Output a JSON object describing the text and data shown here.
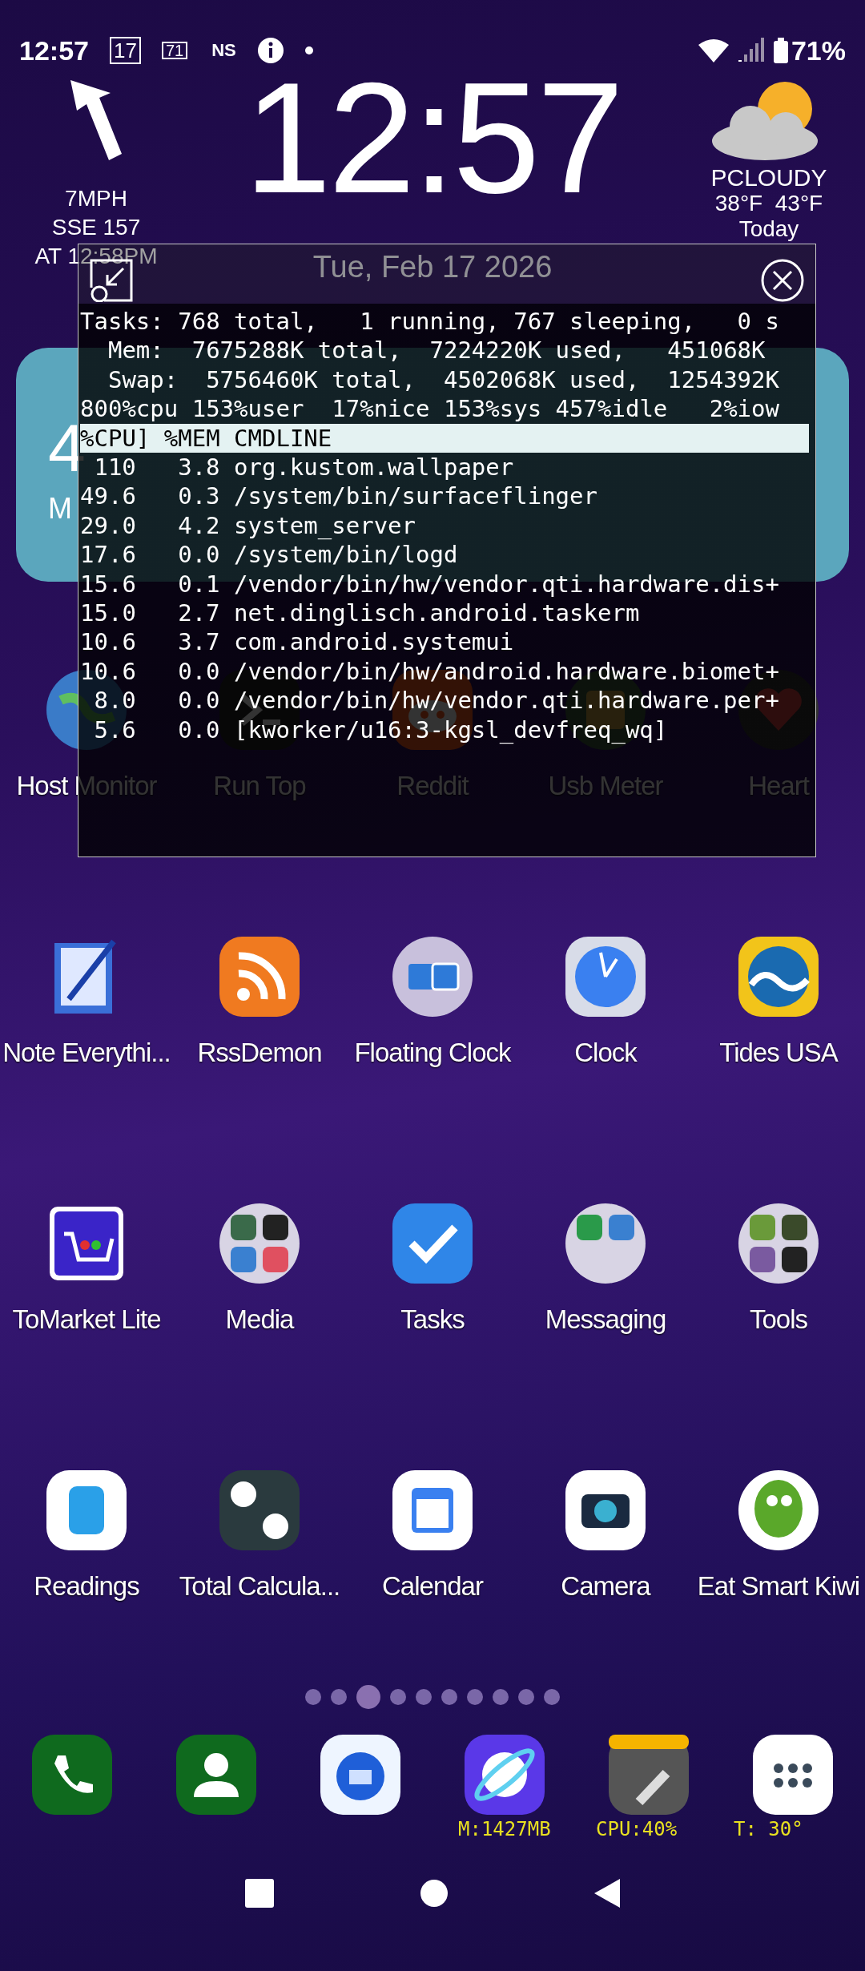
{
  "status_bar": {
    "time": "12:57",
    "badges": [
      {
        "kind": "box",
        "text": "17"
      },
      {
        "kind": "battery",
        "text": "71"
      },
      {
        "kind": "plain",
        "text": "NS"
      }
    ],
    "battery": "71%"
  },
  "wind": {
    "speed": "7MPH",
    "direction": "SSE 157",
    "updated": "AT 12:58PM"
  },
  "clock": {
    "time": "12:57",
    "date": "Tue, Feb 17 2026"
  },
  "weather": {
    "condition": "PCLOUDY",
    "range": "38°F  43°F",
    "day": "Today"
  },
  "weather_widget": {
    "temperature": "4",
    "condition": "M"
  },
  "top_overlay": {
    "summary": [
      "Tasks: 768 total,   1 running, 767 sleeping,   0 s",
      "  Mem:  7675288K total,  7224220K used,   451068K",
      "  Swap:  5756460K total,  4502068K used,  1254392K",
      "800%cpu 153%user  17%nice 153%sys 457%idle   2%iow"
    ],
    "header": "%CPU] %MEM CMDLINE",
    "processes": [
      {
        "cpu": "110",
        "mem": "3.8",
        "cmdline": "org.kustom.wallpaper"
      },
      {
        "cpu": "49.6",
        "mem": "0.3",
        "cmdline": "/system/bin/surfaceflinger"
      },
      {
        "cpu": "29.0",
        "mem": "4.2",
        "cmdline": "system_server"
      },
      {
        "cpu": "17.6",
        "mem": "0.0",
        "cmdline": "/system/bin/logd"
      },
      {
        "cpu": "15.6",
        "mem": "0.1",
        "cmdline": "/vendor/bin/hw/vendor.qti.hardware.dis+"
      },
      {
        "cpu": "15.0",
        "mem": "2.7",
        "cmdline": "net.dinglisch.android.taskerm"
      },
      {
        "cpu": "10.6",
        "mem": "3.7",
        "cmdline": "com.android.systemui"
      },
      {
        "cpu": "10.6",
        "mem": "0.0",
        "cmdline": "/vendor/bin/hw/android.hardware.biomet+"
      },
      {
        "cpu": "8.0",
        "mem": "0.0",
        "cmdline": "/vendor/bin/hw/vendor.qti.hardware.per+"
      },
      {
        "cpu": "5.6",
        "mem": "0.0",
        "cmdline": "[kworker/u16:3-kgsl_devfreq_wq]"
      }
    ]
  },
  "app_rows": [
    [
      {
        "label": "Host Monitor"
      },
      {
        "label": "Run Top"
      },
      {
        "label": "Reddit"
      },
      {
        "label": "Usb Meter"
      },
      {
        "label": "Heart"
      }
    ],
    [
      {
        "label": "Note Everythi..."
      },
      {
        "label": "RssDemon"
      },
      {
        "label": "Floating Clock"
      },
      {
        "label": "Clock"
      },
      {
        "label": "Tides USA"
      }
    ],
    [
      {
        "label": "ToMarket Lite"
      },
      {
        "label": "Media"
      },
      {
        "label": "Tasks"
      },
      {
        "label": "Messaging"
      },
      {
        "label": "Tools"
      }
    ],
    [
      {
        "label": "Readings"
      },
      {
        "label": "Total Calcula..."
      },
      {
        "label": "Calendar"
      },
      {
        "label": "Camera"
      },
      {
        "label": "Eat Smart Kiwi"
      }
    ]
  ],
  "page_dots": [
    {
      "selected": false
    },
    {
      "selected": false
    },
    {
      "selected": true
    },
    {
      "selected": false
    },
    {
      "selected": false
    },
    {
      "selected": false
    },
    {
      "selected": false
    },
    {
      "selected": false
    },
    {
      "selected": false
    },
    {
      "selected": false
    }
  ],
  "dock_stats": [
    "M:1427MB",
    "CPU:40%",
    "T: 30°"
  ]
}
